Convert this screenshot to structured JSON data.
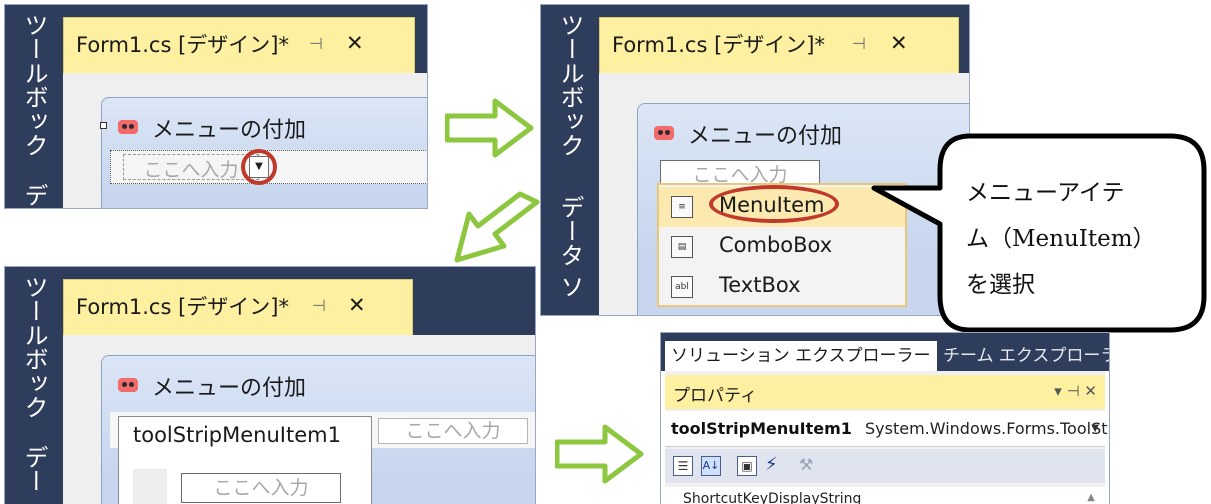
{
  "tab_title": "Form1.cs [デザイン]*",
  "tab_pin": "⊣",
  "tab_close": "✕",
  "sidebar_toolbox": "ツールボックス",
  "sidebar_datasource_short": "デ",
  "sidebar_datasource_part": "データ ソース",
  "sidebar_data_part": "デー",
  "form_title": "メニューの付加",
  "menu_placeholder": "ここへ入力",
  "dropdown_items": [
    {
      "label": "MenuItem",
      "icon": "menu-item-icon"
    },
    {
      "label": "ComboBox",
      "icon": "combobox-icon"
    },
    {
      "label": "TextBox",
      "icon": "textbox-icon"
    }
  ],
  "callout_text_lines": [
    "メニューアイテ",
    "ム（MenuItem）",
    "を選択"
  ],
  "menu_item_name": "toolStripMenuItem1",
  "solution_tabs": [
    "ソリューション エクスプローラー",
    "チーム エクスプローラー"
  ],
  "properties_title": "プロパティ",
  "properties_window_controls": "▾ ⊣ ✕",
  "object_name": "toolStripMenuItem1",
  "object_type": "System.Windows.Forms.ToolStri",
  "property_row": "ShortcutKeyDisplayString",
  "colors": {
    "tab_yellow": "#fdf0a0",
    "dark_blue": "#2f3d5c",
    "highlight_red": "#c0392b",
    "arrow_green": "#8dc63f"
  }
}
